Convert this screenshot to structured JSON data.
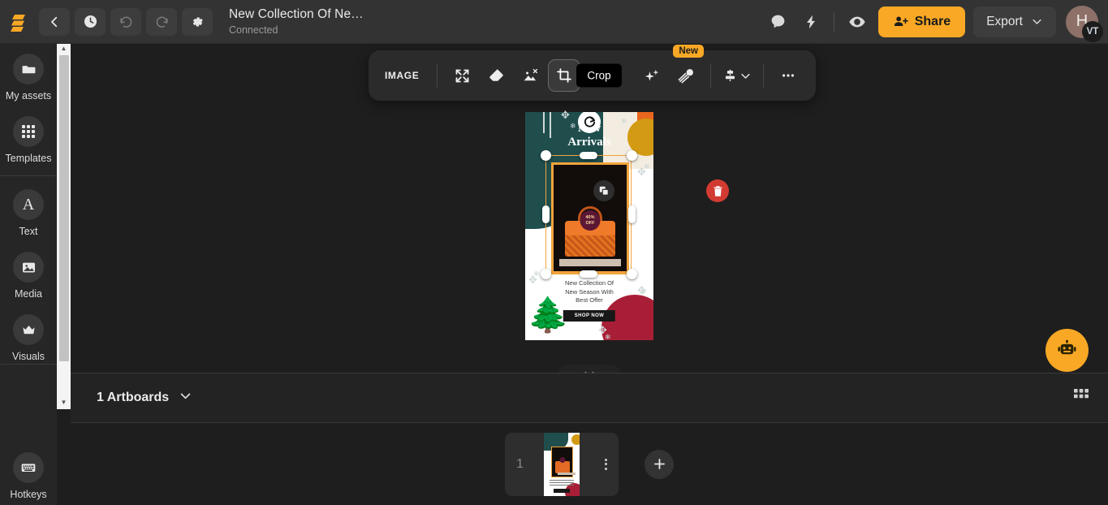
{
  "header": {
    "logo_icon": "brand-logo-icon",
    "buttons": [
      {
        "name": "back-button",
        "icon": "chevron-left-icon"
      },
      {
        "name": "history-button",
        "icon": "clock-icon"
      },
      {
        "name": "undo-button",
        "icon": "undo-icon"
      },
      {
        "name": "redo-button",
        "icon": "redo-icon"
      },
      {
        "name": "settings-button",
        "icon": "gear-icon"
      }
    ],
    "title": "New Collection Of Ne…",
    "status": "Connected",
    "comment_icon": "comment-icon",
    "bolt_icon": "lightning-bolt-icon",
    "preview_icon": "eye-icon",
    "share_label": "Share",
    "share_icon": "user-plus-icon",
    "share_color": "#f9a825",
    "export_label": "Export",
    "export_chevron": "chevron-down-icon",
    "avatar_initial": "H",
    "avatar_badge": "VT"
  },
  "sidebar": {
    "items": [
      {
        "label": "My assets",
        "icon": "folder-icon"
      },
      {
        "label": "Templates",
        "icon": "grid-icon"
      },
      {
        "label": "Text",
        "icon": "letter-a-icon"
      },
      {
        "label": "Media",
        "icon": "image-icon"
      },
      {
        "label": "Visuals",
        "icon": "crown-icon"
      }
    ],
    "bottom": {
      "label": "Hotkeys",
      "icon": "keyboard-icon"
    }
  },
  "toolbar": {
    "type_label": "IMAGE",
    "tools": [
      {
        "name": "resize-tool",
        "icon": "expand-arrows-icon"
      },
      {
        "name": "eraser-tool",
        "icon": "eraser-icon"
      },
      {
        "name": "remove-background-tool",
        "icon": "remove-bg-icon"
      },
      {
        "name": "crop-tool",
        "icon": "crop-icon"
      },
      {
        "name": "ai-enhance-tool",
        "icon": "sparkles-icon"
      },
      {
        "name": "magic-brush-tool",
        "icon": "magic-wand-icon"
      },
      {
        "name": "align-tool",
        "icon": "align-icon"
      },
      {
        "name": "more-options",
        "icon": "ellipsis-icon"
      }
    ],
    "active_tooltip": "Crop",
    "new_badge": "New"
  },
  "canvas": {
    "artwork": {
      "headline_line1": "New",
      "headline_line2": "Arrivals",
      "badge_line1": "40%",
      "badge_line2": "OFF",
      "subtitle_line1": "New Collection Of",
      "subtitle_line2": "New Season With",
      "subtitle_line3": "Best Offer",
      "cta_label": "SHOP NOW"
    },
    "selection": {
      "rotate_icon": "rotate-icon",
      "duplicate_icon": "duplicate-icon",
      "delete_icon": "trash-icon"
    },
    "collapse_icon": "chevron-down-icon",
    "ai_assistant_icon": "robot-icon",
    "ai_assistant_color": "#f9a825"
  },
  "artboard_bar": {
    "count_label": "1 Artboards",
    "chevron_icon": "chevron-down-icon",
    "grid_icon": "grid-view-icon"
  },
  "filmstrip": {
    "thumb_number": "1",
    "menu_icon": "vertical-dots-icon",
    "add_icon": "plus-icon"
  }
}
